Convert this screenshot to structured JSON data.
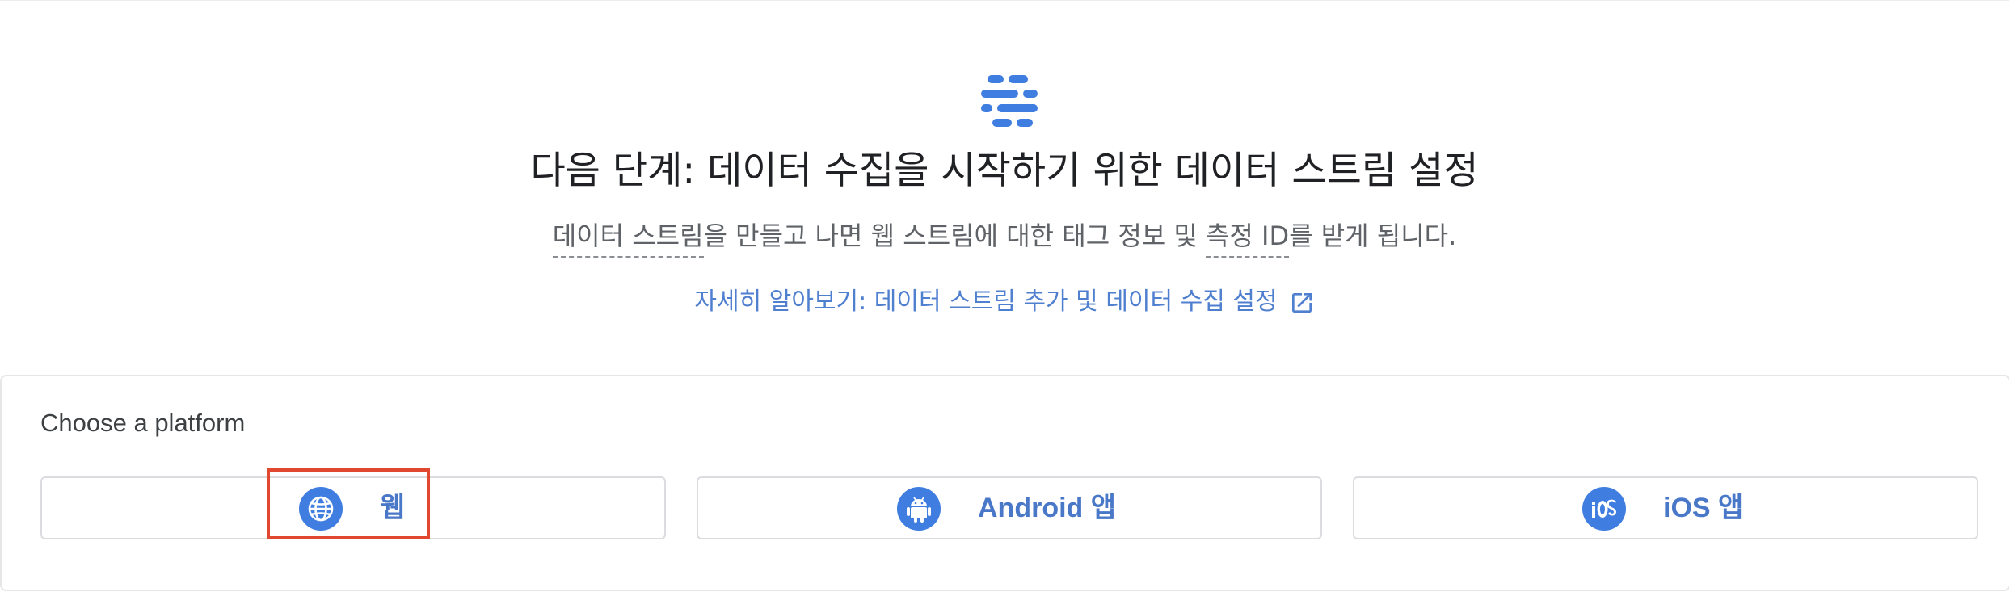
{
  "header": {
    "icon": "stream-lines-icon",
    "title": "다음 단계: 데이터 수집을 시작하기 위한 데이터 스트림 설정",
    "subtext_term1": "데이터 스트림",
    "subtext_mid": "을 만들고 나면 웹 스트림에 대한 태그 정보 및 ",
    "subtext_term2": "측정 ID",
    "subtext_end": "를 받게 됩니다.",
    "learn_link": "자세히 알아보기: 데이터 스트림 추가 및 데이터 수집 설정",
    "learn_link_icon": "open-in-new-icon"
  },
  "platform": {
    "label": "Choose a platform",
    "options": [
      {
        "label": "웹",
        "icon": "globe-icon"
      },
      {
        "label": "Android 앱",
        "icon": "android-icon"
      },
      {
        "label": "iOS 앱",
        "icon": "ios-icon"
      }
    ]
  },
  "colors": {
    "accent": "#4a78c8",
    "icon_blue": "#3f7ee0",
    "highlight": "#e0482f",
    "text": "#202124",
    "subtext": "#5f6368"
  }
}
